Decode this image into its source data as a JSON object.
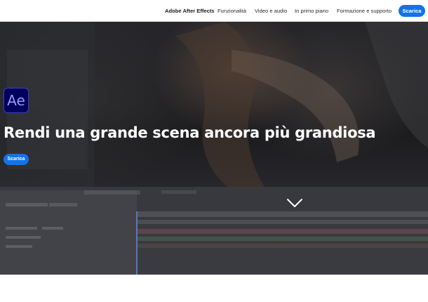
{
  "nav": {
    "brand": "Adobe After Effects",
    "items": [
      {
        "label": "Funzionalità"
      },
      {
        "label": "Video e audio"
      },
      {
        "label": "In primo piano"
      },
      {
        "label": "Formazione e supporto"
      }
    ],
    "cta_label": "Scarica"
  },
  "hero": {
    "logo_text": "Ae",
    "title": "Rendi una grande scena ancora più grandiosa",
    "cta_label": "Scarica",
    "scroll_icon": "chevron-down-icon"
  },
  "colors": {
    "accent": "#1473e6",
    "logo_bg": "#00005b",
    "logo_text": "#9999ff",
    "hero_text": "#ffffff"
  }
}
